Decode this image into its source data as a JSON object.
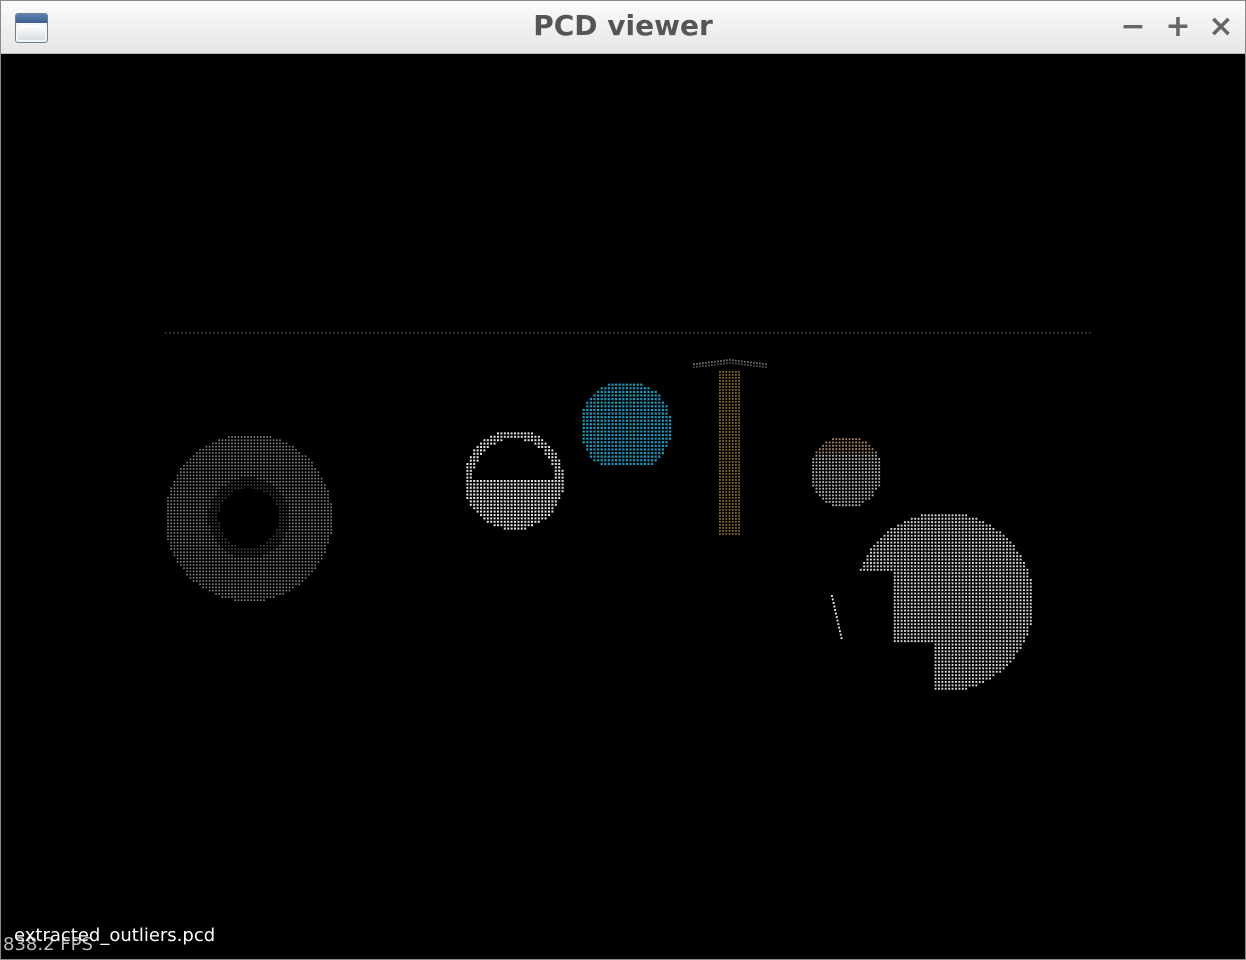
{
  "window": {
    "title": "PCD viewer",
    "controls": {
      "minimize_icon": "minus-icon",
      "maximize_icon": "plus-icon",
      "close_icon": "close-icon",
      "minimize_glyph": "−",
      "maximize_glyph": "+",
      "close_glyph": "×"
    },
    "app_icon": "window-icon"
  },
  "viewer": {
    "background": "#000000",
    "overlay_filename": "extracted_outliers.pcd",
    "overlay_fps": "838.2 FPS",
    "point_colors": {
      "torus": "#bfbfbf",
      "sphere_small": "#ffffff",
      "cap_cyan": "#1aa0c8",
      "hammer": "#b08a3a",
      "sphere_tinted": "#d8d8d8",
      "sphere_large": "#ffffff",
      "horizon_line": "#6a5a3a"
    }
  }
}
